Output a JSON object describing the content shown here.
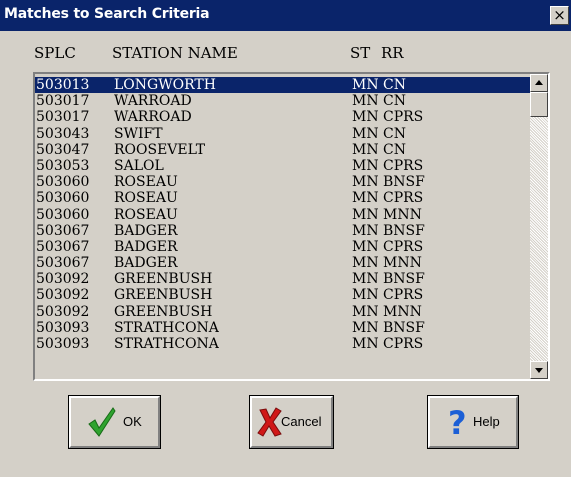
{
  "window": {
    "title": "Matches to Search Criteria",
    "close_label": "×"
  },
  "columns": {
    "splc": "SPLC",
    "station": "STATION NAME",
    "st": "ST",
    "rr": "RR"
  },
  "rows": [
    {
      "splc": "503013",
      "station": "LONGWORTH",
      "st": "MN",
      "rr": "CN",
      "selected": true
    },
    {
      "splc": "503017",
      "station": "WARROAD",
      "st": "MN",
      "rr": "CN"
    },
    {
      "splc": "503017",
      "station": "WARROAD",
      "st": "MN",
      "rr": "CPRS"
    },
    {
      "splc": "503043",
      "station": "SWIFT",
      "st": "MN",
      "rr": "CN"
    },
    {
      "splc": "503047",
      "station": "ROOSEVELT",
      "st": "MN",
      "rr": "CN"
    },
    {
      "splc": "503053",
      "station": "SALOL",
      "st": "MN",
      "rr": "CPRS"
    },
    {
      "splc": "503060",
      "station": "ROSEAU",
      "st": "MN",
      "rr": "BNSF"
    },
    {
      "splc": "503060",
      "station": "ROSEAU",
      "st": "MN",
      "rr": "CPRS"
    },
    {
      "splc": "503060",
      "station": "ROSEAU",
      "st": "MN",
      "rr": "MNN"
    },
    {
      "splc": "503067",
      "station": "BADGER",
      "st": "MN",
      "rr": "BNSF"
    },
    {
      "splc": "503067",
      "station": "BADGER",
      "st": "MN",
      "rr": "CPRS"
    },
    {
      "splc": "503067",
      "station": "BADGER",
      "st": "MN",
      "rr": "MNN"
    },
    {
      "splc": "503092",
      "station": "GREENBUSH",
      "st": "MN",
      "rr": "BNSF"
    },
    {
      "splc": "503092",
      "station": "GREENBUSH",
      "st": "MN",
      "rr": "CPRS"
    },
    {
      "splc": "503092",
      "station": "GREENBUSH",
      "st": "MN",
      "rr": "MNN"
    },
    {
      "splc": "503093",
      "station": "STRATHCONA",
      "st": "MN",
      "rr": "BNSF"
    },
    {
      "splc": "503093",
      "station": "STRATHCONA",
      "st": "MN",
      "rr": "CPRS"
    }
  ],
  "buttons": {
    "ok": "OK",
    "cancel": "Cancel",
    "help": "Help"
  },
  "icons": {
    "ok": "checkmark-icon",
    "cancel": "x-icon",
    "help": "question-icon"
  },
  "colors": {
    "selection": "#0a246a",
    "titlebar": "#0a246a",
    "check": "#2fa32f",
    "cancel": "#d01818",
    "help": "#1c5fd6"
  }
}
